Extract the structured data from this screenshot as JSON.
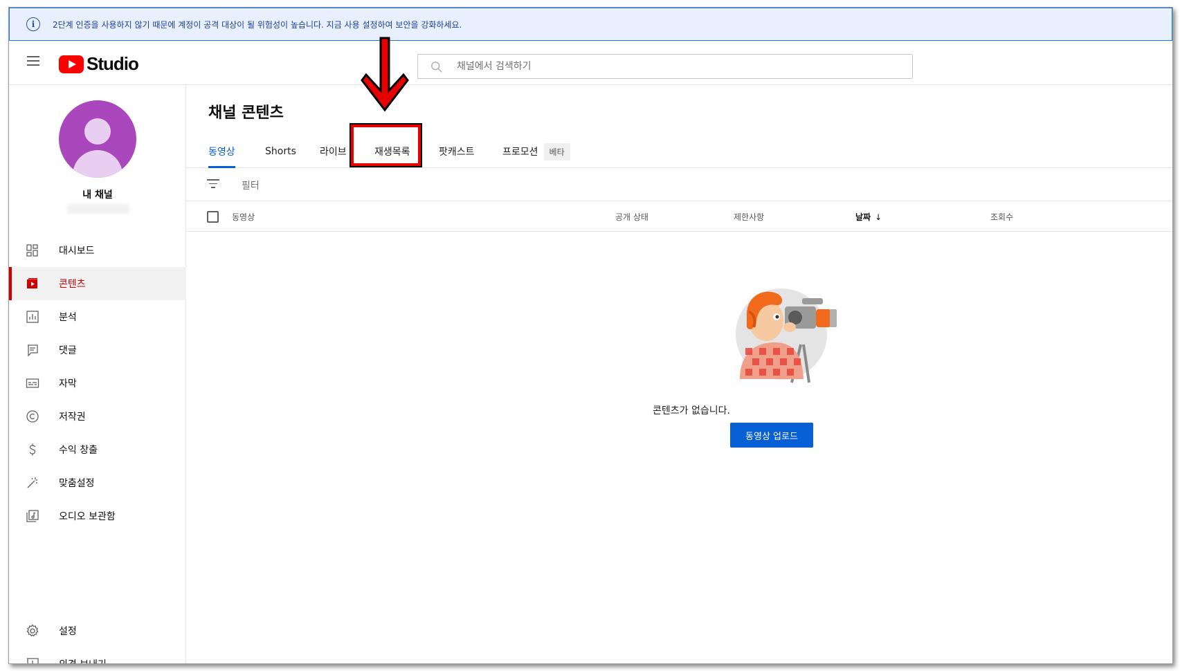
{
  "banner": {
    "icon": "info-icon",
    "text": "2단계 인증을 사용하지 않기 때문에 계정이 공격 대상이 될 위험성이 높습니다. 지금 사용 설정하여 보안을 강화하세요."
  },
  "header": {
    "logo_text": "Studio",
    "search_placeholder": "채널에서 검색하기"
  },
  "sidebar": {
    "channel_name": "내 채널",
    "items": [
      {
        "label": "대시보드",
        "icon": "dashboard-icon",
        "active": false
      },
      {
        "label": "콘텐츠",
        "icon": "content-icon",
        "active": true
      },
      {
        "label": "분석",
        "icon": "analytics-icon",
        "active": false
      },
      {
        "label": "댓글",
        "icon": "comments-icon",
        "active": false
      },
      {
        "label": "자막",
        "icon": "subtitles-icon",
        "active": false
      },
      {
        "label": "저작권",
        "icon": "copyright-icon",
        "active": false
      },
      {
        "label": "수익 창출",
        "icon": "monetization-icon",
        "active": false
      },
      {
        "label": "맞춤설정",
        "icon": "customization-icon",
        "active": false
      },
      {
        "label": "오디오 보관함",
        "icon": "audio-library-icon",
        "active": false
      }
    ],
    "bottom_items": [
      {
        "label": "설정",
        "icon": "settings-icon"
      },
      {
        "label": "의견 보내기",
        "icon": "feedback-icon"
      }
    ]
  },
  "main": {
    "title": "채널 콘텐츠",
    "tabs": [
      {
        "label": "동영상",
        "active": true
      },
      {
        "label": "Shorts",
        "active": false
      },
      {
        "label": "라이브",
        "active": false
      },
      {
        "label": "재생목록",
        "active": false,
        "highlighted": true
      },
      {
        "label": "팟캐스트",
        "active": false
      },
      {
        "label": "프로모션",
        "active": false,
        "badge": "베타"
      }
    ],
    "filter_label": "필터",
    "columns": {
      "video": "동영상",
      "visibility": "공개 상태",
      "restrictions": "제한사항",
      "date": "날짜",
      "views": "조회수"
    },
    "empty_text": "콘텐츠가 없습니다.",
    "upload_button": "동영상 업로드"
  },
  "colors": {
    "accent": "#065fd4",
    "active_nav": "#cc0000",
    "annotation": "#e60000"
  }
}
